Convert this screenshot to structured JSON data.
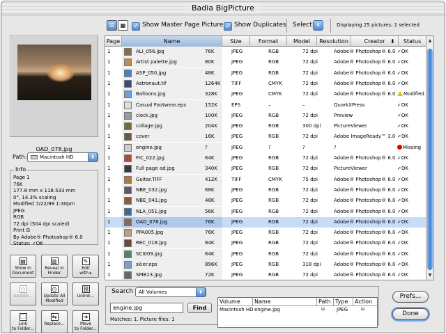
{
  "window": {
    "title": "Badia BigPicture"
  },
  "preview": {
    "filename": "OAD_078.jpg"
  },
  "path": {
    "label": "Path:",
    "value": "Macintosh HD"
  },
  "info": {
    "title": "Info",
    "lines": [
      "Page 1",
      "76K",
      "177.8 mm x 118.533 mm",
      "0°, 14.3% scaling",
      "Modified 7/22/98 1:30pm",
      "JPEG",
      "RGB",
      "72 dpi  (504 dpi  scaled)",
      "Print",
      "By Adobe® Photoshop® 6.0",
      "Status: ✓OK"
    ]
  },
  "actions": [
    {
      "label1": "Show in",
      "label2": "Document",
      "icon": "page-icon",
      "glyph": "▤",
      "enabled": true
    },
    {
      "label1": "Reveal in",
      "label2": "Finder",
      "icon": "finder-icon",
      "glyph": "▥",
      "enabled": true
    },
    {
      "label1": "Edit",
      "label2": "with ▸",
      "icon": "edit-icon",
      "glyph": "✎",
      "enabled": true
    },
    {
      "label1": "Update...",
      "label2": "",
      "icon": "clock-icon",
      "glyph": "◷",
      "enabled": false
    },
    {
      "label1": "Update All",
      "label2": "Modified",
      "icon": "clock-all-icon",
      "glyph": "◷",
      "enabled": true
    },
    {
      "label1": "Unlink...",
      "label2": "",
      "icon": "unlink-icon",
      "glyph": "⛓",
      "enabled": true
    },
    {
      "label1": "Link",
      "label2": "to Folder...",
      "icon": "link-folder-icon",
      "glyph": "🗀",
      "enabled": true
    },
    {
      "label1": "Replace...",
      "label2": "",
      "icon": "replace-icon",
      "glyph": "⇆",
      "enabled": true
    },
    {
      "label1": "Move",
      "label2": "to Folder...",
      "icon": "move-folder-icon",
      "glyph": "➜",
      "enabled": true
    }
  ],
  "toolbar": {
    "show_master_pages": "Show Master Page Pictures",
    "show_duplicates": "Show Duplicates",
    "select_label": "Select:",
    "display_text": "Displaying 25 pictures; 1 selected"
  },
  "table": {
    "headers": [
      "Page",
      "Name",
      "Size",
      "Format",
      "Model",
      "Resolution",
      "Creator",
      "Status"
    ],
    "rows": [
      [
        "1",
        "ALI_056.jpg",
        "76K",
        "JPEG",
        "RGB",
        "72 dpi",
        "Adobe® Photoshop® 6.0",
        "✓OK",
        "ok",
        "#8a6a4a"
      ],
      [
        "1",
        "Artist palette.jpg",
        "80K",
        "JPEG",
        "RGB",
        "72 dpi",
        "Adobe® Photoshop® 6.0",
        "✓OK",
        "ok",
        "#c08a50"
      ],
      [
        "1",
        "ASP_050.jpg",
        "48K",
        "JPEG",
        "RGB",
        "72 dpi",
        "Adobe® Photoshop® 6.0",
        "✓OK",
        "ok",
        "#4f7fb8"
      ],
      [
        "1",
        "Astronaut.tif",
        "1264K",
        "TIFF",
        "CMYK",
        "72 dpi",
        "Adobe® Photoshop® 6.0",
        "✓OK",
        "ok",
        "#3a4d7a"
      ],
      [
        "1",
        "Balloons.jpg",
        "328K",
        "JPEG",
        "CMYK",
        "72 dpi",
        "Adobe® Photoshop® 6.0",
        "Modified",
        "warn",
        "#6aa0e0"
      ],
      [
        "1",
        "Casual Footwear.eps",
        "152K",
        "EPS",
        "–",
        "–",
        "QuarkXPress",
        "✓OK",
        "ok",
        "#dddddd"
      ],
      [
        "1",
        "clock.jpg",
        "100K",
        "JPEG",
        "RGB",
        "72 dpi",
        "Preview",
        "✓OK",
        "ok",
        "#9a9a9a"
      ],
      [
        "1",
        "collage.jpg",
        "204K",
        "JPEG",
        "RGB",
        "300 dpi",
        "PictureViewer",
        "✓OK",
        "ok",
        "#7a6a3a"
      ],
      [
        "1",
        "cover",
        "16K",
        "JPEG",
        "RGB",
        "72 dpi",
        "Adobe ImageReady™ 3.0",
        "✓OK",
        "ok",
        "#6a5a4a"
      ],
      [
        "1",
        "engine.jpg",
        "?",
        "JPEG",
        "?",
        "?",
        "?",
        "Missing",
        "missing",
        "#cccccc"
      ],
      [
        "1",
        "FIC_022.jpg",
        "64K",
        "JPEG",
        "RGB",
        "72 dpi",
        "Adobe® Photoshop® 6.0",
        "✓OK",
        "ok",
        "#b04a3a"
      ],
      [
        "1",
        "Full page ad.jpg",
        "340K",
        "JPEG",
        "RGB",
        "72 dpi",
        "PictureViewer",
        "✓OK",
        "ok",
        "#3a3a3a"
      ],
      [
        "1",
        "Guitar.TIFF",
        "412K",
        "TIFF",
        "CMYK",
        "75 dpi",
        "Adobe® Photoshop® 6.0",
        "✓OK",
        "ok",
        "#b07a3a"
      ],
      [
        "1",
        "NBE_032.jpg",
        "68K",
        "JPEG",
        "RGB",
        "72 dpi",
        "Adobe® Photoshop® 6.0",
        "✓OK",
        "ok",
        "#5a5a6a"
      ],
      [
        "1",
        "NBE_041.jpg",
        "48K",
        "JPEG",
        "RGB",
        "72 dpi",
        "Adobe® Photoshop® 6.0",
        "✓OK",
        "ok",
        "#8a5a3a"
      ],
      [
        "1",
        "NLA_051.jpg",
        "56K",
        "JPEG",
        "RGB",
        "72 dpi",
        "Adobe® Photoshop® 6.0",
        "✓OK",
        "ok",
        "#3a6a9a"
      ],
      [
        "1",
        "OAD_078.jpg",
        "76K",
        "JPEG",
        "RGB",
        "72 dpi",
        "Adobe® Photoshop® 6.0",
        "✓OK",
        "ok",
        "#8a6a4a"
      ],
      [
        "1",
        "PPA005.jpg",
        "76K",
        "JPEG",
        "RGB",
        "72 dpi",
        "Adobe® Photoshop® 6.0",
        "✓OK",
        "ok",
        "#c0a070"
      ],
      [
        "1",
        "REC_018.jpg",
        "84K",
        "JPEG",
        "RGB",
        "72 dpi",
        "Adobe® Photoshop® 6.0",
        "✓OK",
        "ok",
        "#6a4a3a"
      ],
      [
        "1",
        "SCI009.jpg",
        "64K",
        "JPEG",
        "RGB",
        "72 dpi",
        "Adobe® Photoshop® 6.0",
        "✓OK",
        "ok",
        "#4a8a6a"
      ],
      [
        "1",
        "skier.eps",
        "896K",
        "JPEG",
        "RGB",
        "318 dpi",
        "Adobe® Photoshop® 6.0",
        "✓OK",
        "ok",
        "#7aa0d0"
      ],
      [
        "1",
        "SMB13.jpg",
        "72K",
        "JPEG",
        "RGB",
        "72 dpi",
        "Adobe® Photoshop® 6.0",
        "✓OK",
        "ok",
        "#6a6a6a"
      ]
    ],
    "selected_index": 16
  },
  "search": {
    "label": "Search",
    "scope": "All Volumes",
    "query": "engine.jpg",
    "find_label": "Find",
    "matches": "Matches: 1. Picture files: 1",
    "headers": [
      "Volume",
      "Name",
      "Path",
      "Type",
      "Action"
    ],
    "result": {
      "volume": "Macintosh HD",
      "name": "engine.jpg",
      "type": "JPEG"
    }
  },
  "buttons": {
    "prefs": "Prefs...",
    "done": "Done"
  },
  "colors": {
    "selection": "#c7dcf6",
    "aqua_blue": "#4f8ad2",
    "missing": "#e00000",
    "warning": "#e5c000"
  }
}
